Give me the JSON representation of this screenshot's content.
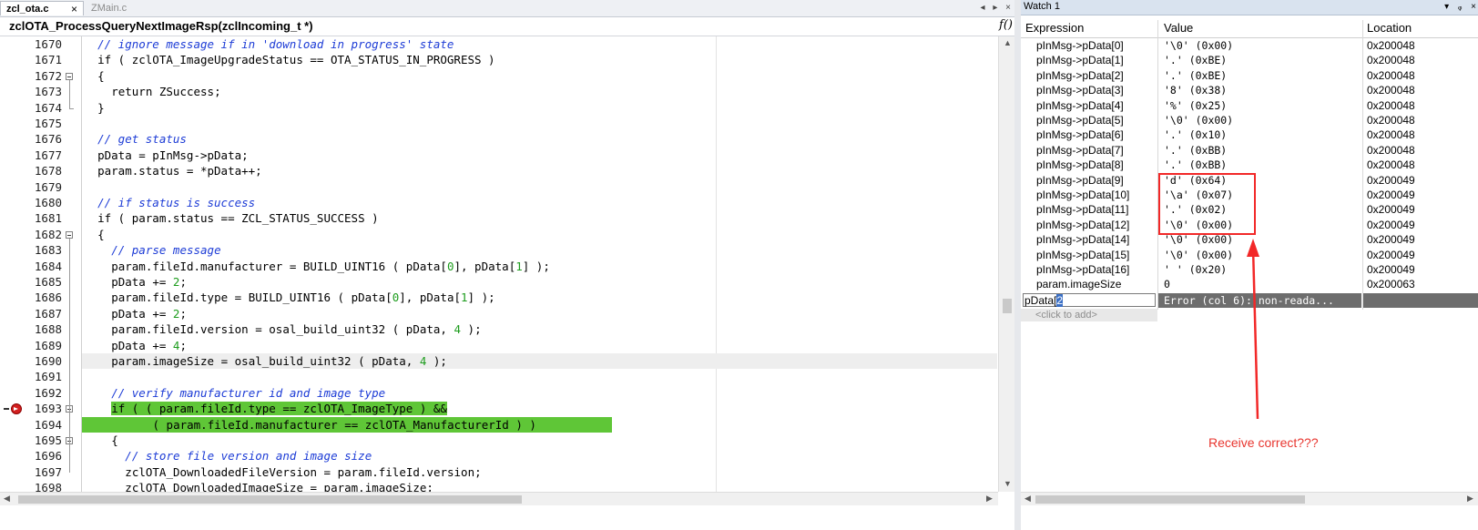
{
  "editor": {
    "tabs": [
      {
        "label": "zcl_ota.c",
        "close": "×",
        "active": true
      },
      {
        "label": "ZMain.c",
        "active": false
      }
    ],
    "tabbar_buttons": {
      "left": "◂",
      "right": "▸",
      "close": "×"
    },
    "function_name": "zclOTA_ProcessQueryNextImageRsp(zclIncoming_t *)",
    "function_icon": "f()",
    "lines": [
      {
        "num": "1670",
        "text": "// ignore message if in 'download in progress' state",
        "comment": true,
        "indent": 2
      },
      {
        "num": "1671",
        "text": "if ( zclOTA_ImageUpgradeStatus == OTA_STATUS_IN_PROGRESS )",
        "indent": 2
      },
      {
        "num": "1672",
        "text": "{",
        "indent": 2,
        "fold": true
      },
      {
        "num": "1673",
        "text": "return ZSuccess;",
        "indent": 4
      },
      {
        "num": "1674",
        "text": "}",
        "indent": 2,
        "foldend": true
      },
      {
        "num": "1675",
        "text": "",
        "indent": 0
      },
      {
        "num": "1676",
        "text": "// get status",
        "comment": true,
        "indent": 2
      },
      {
        "num": "1677",
        "text": "pData = pInMsg->pData;",
        "indent": 2
      },
      {
        "num": "1678",
        "text": "param.status = *pData++;",
        "indent": 2
      },
      {
        "num": "1679",
        "text": "",
        "indent": 0
      },
      {
        "num": "1680",
        "text": "// if status is success",
        "comment": true,
        "indent": 2
      },
      {
        "num": "1681",
        "text": "if ( param.status == ZCL_STATUS_SUCCESS )",
        "indent": 2
      },
      {
        "num": "1682",
        "text": "{",
        "indent": 2,
        "fold": true
      },
      {
        "num": "1683",
        "text": "// parse message",
        "comment": true,
        "indent": 4
      },
      {
        "num": "1684",
        "parts": [
          {
            "t": "param.fileId.manufacturer = BUILD_UINT16 ( pData["
          },
          {
            "t": "0",
            "n": true
          },
          {
            "t": "], pData["
          },
          {
            "t": "1",
            "n": true
          },
          {
            "t": "] );"
          }
        ],
        "indent": 4
      },
      {
        "num": "1685",
        "parts": [
          {
            "t": "pData += "
          },
          {
            "t": "2",
            "n": true
          },
          {
            "t": ";"
          }
        ],
        "indent": 4
      },
      {
        "num": "1686",
        "parts": [
          {
            "t": "param.fileId.type = BUILD_UINT16 ( pData["
          },
          {
            "t": "0",
            "n": true
          },
          {
            "t": "], pData["
          },
          {
            "t": "1",
            "n": true
          },
          {
            "t": "] );"
          }
        ],
        "indent": 4
      },
      {
        "num": "1687",
        "parts": [
          {
            "t": "pData += "
          },
          {
            "t": "2",
            "n": true
          },
          {
            "t": ";"
          }
        ],
        "indent": 4
      },
      {
        "num": "1688",
        "parts": [
          {
            "t": "param.fileId.version = osal_build_uint32 ( pData, "
          },
          {
            "t": "4",
            "n": true
          },
          {
            "t": " );"
          }
        ],
        "indent": 4
      },
      {
        "num": "1689",
        "parts": [
          {
            "t": "pData += "
          },
          {
            "t": "4",
            "n": true
          },
          {
            "t": ";"
          }
        ],
        "indent": 4
      },
      {
        "num": "1690",
        "parts": [
          {
            "t": "param.imageSize = osal_build_uint32 ( pData, "
          },
          {
            "t": "4",
            "n": true
          },
          {
            "t": " );"
          }
        ],
        "indent": 4,
        "current": true
      },
      {
        "num": "1691",
        "text": "",
        "indent": 0
      },
      {
        "num": "1692",
        "text": "// verify manufacturer id and image type",
        "comment": true,
        "indent": 4
      },
      {
        "num": "1693",
        "text": "if ( ( param.fileId.type == zclOTA_ImageType ) &&",
        "indent": 4,
        "highlight": true,
        "fold": true,
        "breakpoint": true
      },
      {
        "num": "1694",
        "text": "( param.fileId.manufacturer == zclOTA_ManufacturerId ) )",
        "indent": 10,
        "highlight_full": true
      },
      {
        "num": "1695",
        "text": "{",
        "indent": 4,
        "fold": true
      },
      {
        "num": "1696",
        "text": "// store file version and image size",
        "comment": true,
        "indent": 6
      },
      {
        "num": "1697",
        "text": "zclOTA_DownloadedFileVersion = param.fileId.version;",
        "indent": 6
      },
      {
        "num": "1698",
        "text": "zclOTA_DownloadedImageSize = param.imageSize;",
        "indent": 6
      }
    ]
  },
  "watch": {
    "title": "Watch 1",
    "title_buttons": {
      "dropdown": "▾",
      "pin": "ᵩ",
      "close": "×"
    },
    "columns": {
      "expression": "Expression",
      "value": "Value",
      "location": "Location"
    },
    "rows": [
      {
        "expr": "pInMsg->pData[0]",
        "value": "'\\0' (0x00)",
        "loc": "0x200048"
      },
      {
        "expr": "pInMsg->pData[1]",
        "value": "'.' (0xBE)",
        "loc": "0x200048"
      },
      {
        "expr": "pInMsg->pData[2]",
        "value": "'.' (0xBE)",
        "loc": "0x200048"
      },
      {
        "expr": "pInMsg->pData[3]",
        "value": "'8' (0x38)",
        "loc": "0x200048"
      },
      {
        "expr": "pInMsg->pData[4]",
        "value": "'%' (0x25)",
        "loc": "0x200048"
      },
      {
        "expr": "pInMsg->pData[5]",
        "value": "'\\0' (0x00)",
        "loc": "0x200048"
      },
      {
        "expr": "pInMsg->pData[6]",
        "value": "'.' (0x10)",
        "loc": "0x200048"
      },
      {
        "expr": "pInMsg->pData[7]",
        "value": "'.' (0xBB)",
        "loc": "0x200048"
      },
      {
        "expr": "pInMsg->pData[8]",
        "value": "'.' (0xBB)",
        "loc": "0x200048"
      },
      {
        "expr": "pInMsg->pData[9]",
        "value": "'d' (0x64)",
        "loc": "0x200049"
      },
      {
        "expr": "pInMsg->pData[10]",
        "value": "'\\a' (0x07)",
        "loc": "0x200049"
      },
      {
        "expr": "pInMsg->pData[11]",
        "value": "'.' (0x02)",
        "loc": "0x200049"
      },
      {
        "expr": "pInMsg->pData[12]",
        "value": "'\\0' (0x00)",
        "loc": "0x200049"
      },
      {
        "expr": "pInMsg->pData[14]",
        "value": "'\\0' (0x00)",
        "loc": "0x200049"
      },
      {
        "expr": "pInMsg->pData[15]",
        "value": "'\\0' (0x00)",
        "loc": "0x200049"
      },
      {
        "expr": "pInMsg->pData[16]",
        "value": "' ' (0x20)",
        "loc": "0x200049"
      },
      {
        "expr": "param.imageSize",
        "value": "0",
        "loc": "0x200063"
      }
    ],
    "edit": {
      "prefix": "pData[",
      "selected": "2",
      "suffix": ""
    },
    "error_value": "Error (col 6): non-reada...",
    "add_placeholder": "<click to add>",
    "annotation": "Receive correct???"
  },
  "colors": {
    "comment": "#1d3cd6",
    "highlight": "#5fc637",
    "number": "#1d9c1d",
    "annotation": "#e8362f",
    "breakpoint": "#d32020"
  }
}
